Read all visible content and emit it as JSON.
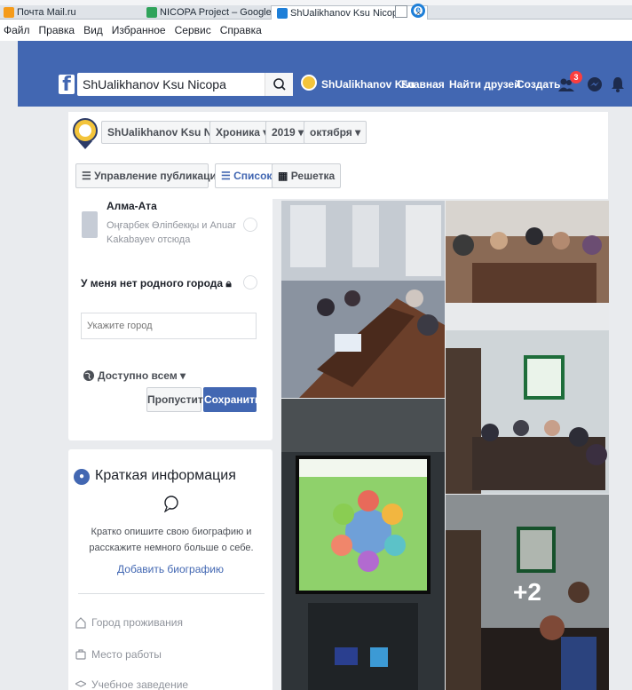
{
  "browser": {
    "tabs": [
      {
        "label": "Почта Mail.ru",
        "favicon_color": "#f59b1a"
      },
      {
        "label": "NICOPA Project – Google Диск",
        "favicon_color": "#2fa35a"
      },
      {
        "label": "ShUalikhanov Ksu Nicopa",
        "favicon_color": "#1e7fd8",
        "close": "×"
      }
    ],
    "menu": [
      "Файл",
      "Правка",
      "Вид",
      "Избранное",
      "Сервис",
      "Справка"
    ]
  },
  "fb_header": {
    "logo": "f",
    "search_value": "ShUalikhanov Ksu Nicopa",
    "profile_name": "ShUalikhanov Ksu",
    "nav": [
      "Главная",
      "Найти друзей",
      "Создать"
    ],
    "friend_requests_count": "3",
    "brand_color": "#4267b2"
  },
  "timeline_nav": {
    "breadcrumbs": [
      "ShUalikhanov Ksu Nicopa",
      "Хроника ▾",
      "2019 ▾",
      "октября ▾"
    ],
    "manage_posts": "Управление публикациями",
    "view_list": "Список",
    "view_grid": "Решетка"
  },
  "city_form": {
    "current_city": "Алма-Ата",
    "current_city_people": "Оңғарбек Өліпбекқы и Anuar Kakabayev отсюда",
    "no_hometown": "У меня нет родного города",
    "city_placeholder": "Укажите город",
    "privacy": "Доступно всем ▾",
    "skip": "Пропустить",
    "save": "Сохранить"
  },
  "intro": {
    "title": "Краткая информация",
    "description": "Кратко опишите свою биографию и расскажите немного больше о себе.",
    "add_bio": "Добавить биографию",
    "items": [
      "Город проживания",
      "Место работы",
      "Учебное заведение"
    ]
  },
  "photos": {
    "more_count": "+2"
  }
}
